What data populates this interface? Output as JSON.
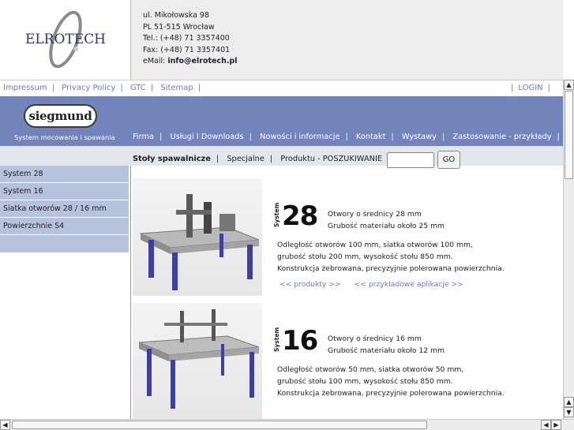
{
  "logo": {
    "text": "ELROTECH"
  },
  "address": {
    "line1": "ul. Mikołowska 98",
    "line2": "PL 51-515 Wrocław",
    "tel": "Tel.: (+48) 71 3357400",
    "fax": "Fax: (+48) 71 3357401",
    "email_label": "eMail:",
    "email": "info@elrotech.pl"
  },
  "toplinks": {
    "left": [
      "Impressum",
      "Privacy Policy",
      "GTC",
      "Sitemap"
    ],
    "right": "LOGIN"
  },
  "brand": {
    "logo_text": "siegmund",
    "tagline": "System mocowania i spawania"
  },
  "mainnav": [
    "Firma",
    "Usługi I Downloads",
    "Nowości i informacje",
    "Kontakt",
    "Wystawy",
    "Zastosowanie - przykłady"
  ],
  "subnav": {
    "items": [
      "Stoły spawalnicze",
      "Specjalne",
      "Produktu - POSZUKIWANIE"
    ],
    "active_index": 0
  },
  "search": {
    "value": "",
    "button": "GO"
  },
  "sidebar": [
    "System 28",
    "System 16",
    "Siatka otworów 28 / 16 mm",
    "Powierzchnie S4"
  ],
  "products": [
    {
      "system_word": "System",
      "number": "28",
      "spec1": "Otwory o średnicy 28 mm",
      "spec2": "Grubość materiału około 25 mm",
      "desc1": "Odległość otworów 100 mm, siatka otworów 100 mm,",
      "desc2": "grubość stołu 200 mm, wysokość stołu 850 mm.",
      "desc3": "Konstrukcja żebrowana, precyzyjnie polerowana powierzchnia.",
      "link1": "<< produkty >>",
      "link2": "<< przykładowe aplikacje >>"
    },
    {
      "system_word": "System",
      "number": "16",
      "spec1": "Otwory o średnicy 16 mm",
      "spec2": "Grubość materiału około 12 mm",
      "desc1": "Odległość otworów 50 mm, siatka otworów 50 mm,",
      "desc2": "grubość stołu 100 mm, wysokość stołu 850 mm.",
      "desc3": "Konstrukcja żebrowana, precyzyjnie polerowana powierzchnia."
    }
  ],
  "colors": {
    "band": "#7384bb",
    "sidebar": "#b7c2dd",
    "link": "#6b7cb2"
  }
}
